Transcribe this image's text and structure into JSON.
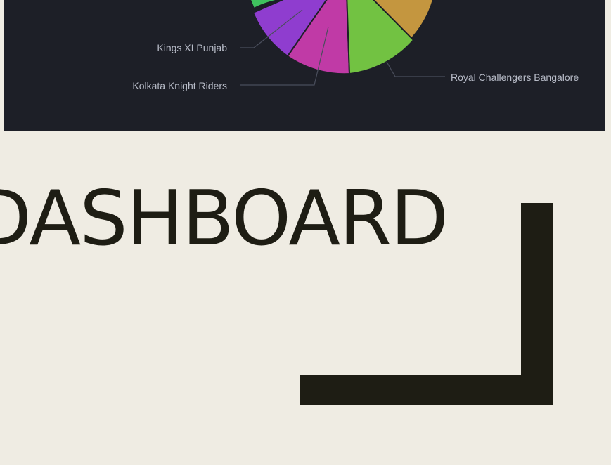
{
  "dashboard": {
    "title": "DASHBOARD"
  },
  "colors": {
    "page_background": "#efece3",
    "panel_background": "#1d1f27",
    "title_text": "#1e1d14",
    "label_text": "#b8bcc8",
    "leader_line": "#4a4e5c",
    "slice_border": "#1d1f27"
  },
  "chart_data": {
    "type": "pie",
    "slices": [
      {
        "name": "Kings XI Punjab",
        "color": "#8f3dcf",
        "label_side": "left"
      },
      {
        "name": "Kolkata Knight Riders",
        "color": "#c03aa6",
        "label_side": "left"
      },
      {
        "name": "Royal Challengers Bangalore",
        "color": "#72c242",
        "label_side": "right"
      }
    ]
  }
}
